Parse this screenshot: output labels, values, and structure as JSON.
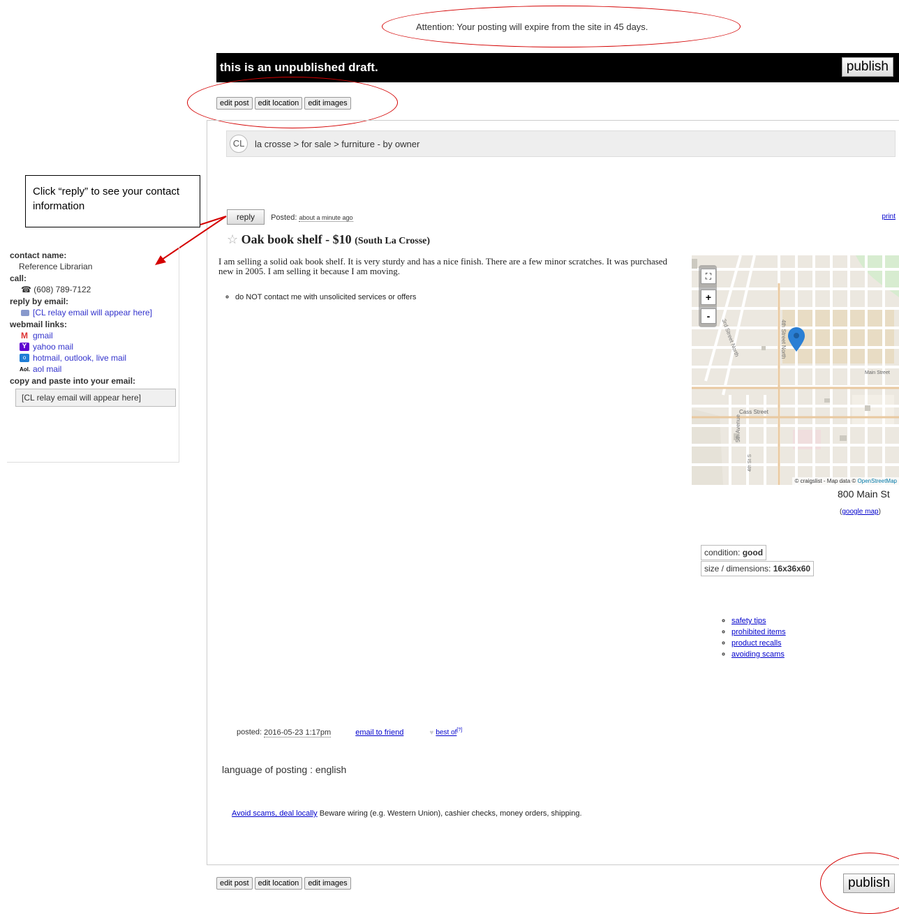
{
  "attention_notice": "Attention: Your posting will expire from the site in 45 days.",
  "draft_bar": {
    "text": "this is an unpublished draft.",
    "publish_label": "publish"
  },
  "edit_buttons": {
    "edit_post": "edit post",
    "edit_location": "edit location",
    "edit_images": "edit images"
  },
  "breadcrumb": {
    "logo": "CL",
    "path": "la crosse > for sale > furniture - by owner"
  },
  "callout": {
    "text": "Click “reply” to see your contact information"
  },
  "reply_row": {
    "reply_label": "reply",
    "posted_label": "Posted:",
    "posted_value": "about a minute ago",
    "print_label": "print"
  },
  "posting": {
    "star": "☆",
    "title": "Oak book shelf - $10",
    "location": "(South La Crosse)",
    "body": "I am selling a solid oak book shelf. It is very sturdy and has a nice finish. There are a few minor scratches. It was purchased new in 2005. I am selling it because I am moving.",
    "notice": "do NOT contact me with unsolicited services or offers"
  },
  "sidebar": {
    "contact_name_label": "contact name:",
    "contact_name": "Reference Librarian",
    "call_label": "call:",
    "phone": "(608) 789-7122",
    "reply_email_label": "reply by email:",
    "relay_email": "[CL relay email will appear here]",
    "webmail_label": "webmail links:",
    "webmail": [
      "gmail",
      "yahoo mail",
      "hotmail, outlook, live mail",
      "aol mail"
    ],
    "aol_prefix": "Aol.",
    "copy_label": "copy and paste into your email:",
    "copy_value": "[CL relay email will appear here]"
  },
  "map": {
    "streets": [
      "Main Street",
      "Cass Street",
      "3rd Street North",
      "4th Street North",
      "5th Avenue",
      "4th St S"
    ],
    "attribution_prefix": "© craigslist - Map data ©",
    "attribution_link": "OpenStreetMap",
    "address": "800 Main St",
    "google_link": "google map"
  },
  "attributes": {
    "condition_label": "condition:",
    "condition_value": "good",
    "size_label": "size / dimensions:",
    "size_value": "16x36x60"
  },
  "safety_links": [
    "safety tips",
    "prohibited items",
    "product recalls",
    "avoiding scams"
  ],
  "footer": {
    "posted_label": "posted:",
    "posted_date": "2016-05-23 1:17pm",
    "email_friend": "email to friend",
    "heart": "♥",
    "best_of": "best of",
    "best_of_sup": "[?]",
    "language_label": "language of posting :",
    "language_value": "english",
    "scam_link": "Avoid scams, deal locally",
    "scam_text": "Beware wiring (e.g. Western Union), cashier checks, money orders, shipping."
  },
  "colors": {
    "annotation_red": "#d40000",
    "link_blue": "#0000cc",
    "draft_bar": "#000000",
    "map_pin": "#2a7fd4"
  }
}
